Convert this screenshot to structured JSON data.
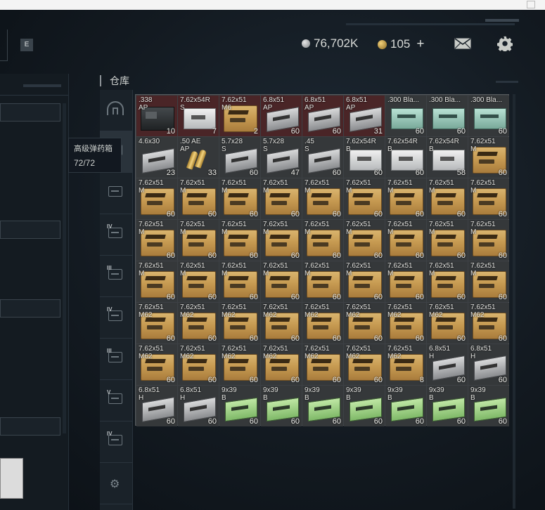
{
  "header": {
    "e_button": "E",
    "silver_amount": "76,702K",
    "gold_amount": "105",
    "add_label": "+"
  },
  "warehouse": {
    "title": "仓库"
  },
  "side_tabs": [
    {
      "level": "",
      "icon": "dome-icon",
      "active": false
    },
    {
      "level": "IV",
      "icon": "ammo-crate-icon",
      "active": true
    },
    {
      "level": "",
      "icon": "crate-icon",
      "active": false
    },
    {
      "level": "IV",
      "icon": "crate-icon",
      "active": false
    },
    {
      "level": "III",
      "icon": "crate-icon",
      "active": false
    },
    {
      "level": "IV",
      "icon": "crate-icon",
      "active": false
    },
    {
      "level": "III",
      "icon": "crate-icon",
      "active": false
    },
    {
      "level": "V",
      "icon": "crate-icon",
      "active": false
    },
    {
      "level": "IV",
      "icon": "crate-icon",
      "active": false
    },
    {
      "level": "",
      "icon": "gear-icon",
      "active": false
    }
  ],
  "tooltip": {
    "name": "高级弹药箱",
    "capacity": "72/72"
  },
  "grid": [
    [
      {
        "cal": ".338",
        "sub": "AP",
        "count": "10",
        "art": "box-dark",
        "red": true
      },
      {
        "cal": "7.62x54R",
        "sub": "S",
        "count": "7",
        "art": "box-white",
        "red": true
      },
      {
        "cal": "7.62x51",
        "sub": "M6",
        "count": "2",
        "art": "box-tan",
        "red": true
      },
      {
        "cal": "6.8x51",
        "sub": "AP",
        "count": "60",
        "art": "box-grey",
        "red": true
      },
      {
        "cal": "6.8x51",
        "sub": "AP",
        "count": "60",
        "art": "box-grey",
        "red": true
      },
      {
        "cal": "6.8x51",
        "sub": "AP",
        "count": "31",
        "art": "box-grey",
        "red": true
      },
      {
        "cal": ".300 Bla...",
        "sub": "",
        "count": "60",
        "art": "box-teal",
        "red": false
      },
      {
        "cal": ".300 Bla...",
        "sub": "",
        "count": "60",
        "art": "box-teal",
        "red": false
      },
      {
        "cal": ".300 Bla...",
        "sub": "",
        "count": "60",
        "art": "box-teal",
        "red": false
      }
    ],
    [
      {
        "cal": "4.6x30",
        "sub": "",
        "count": "23",
        "art": "box-grey",
        "red": false
      },
      {
        "cal": ".50 AE",
        "sub": "AP",
        "count": "33",
        "art": "rounds",
        "red": false
      },
      {
        "cal": "5.7x28",
        "sub": "S",
        "count": "60",
        "art": "box-grey",
        "red": false
      },
      {
        "cal": "5.7x28",
        "sub": "S",
        "count": "47",
        "art": "box-grey",
        "red": false
      },
      {
        "cal": ".45",
        "sub": "S",
        "count": "60",
        "art": "box-grey",
        "red": false
      },
      {
        "cal": "7.62x54R",
        "sub": "B",
        "count": "60",
        "art": "box-white",
        "red": false
      },
      {
        "cal": "7.62x54R",
        "sub": "B",
        "count": "60",
        "art": "box-white",
        "red": false
      },
      {
        "cal": "7.62x54R",
        "sub": "B",
        "count": "58",
        "art": "box-white",
        "red": false
      },
      {
        "cal": "7.62x51",
        "sub": "M",
        "count": "60",
        "art": "box-tan",
        "red": false
      }
    ],
    [
      {
        "cal": "7.62x51",
        "sub": "M",
        "count": "60",
        "art": "box-tan",
        "red": false
      },
      {
        "cal": "7.62x51",
        "sub": "M",
        "count": "60",
        "art": "box-tan",
        "red": false
      },
      {
        "cal": "7.62x51",
        "sub": "M",
        "count": "60",
        "art": "box-tan",
        "red": false
      },
      {
        "cal": "7.62x51",
        "sub": "M",
        "count": "60",
        "art": "box-tan",
        "red": false
      },
      {
        "cal": "7.62x51",
        "sub": "M",
        "count": "60",
        "art": "box-tan",
        "red": false
      },
      {
        "cal": "7.62x51",
        "sub": "M",
        "count": "60",
        "art": "box-tan",
        "red": false
      },
      {
        "cal": "7.62x51",
        "sub": "M",
        "count": "60",
        "art": "box-tan",
        "red": false
      },
      {
        "cal": "7.62x51",
        "sub": "M",
        "count": "60",
        "art": "box-tan",
        "red": false
      },
      {
        "cal": "7.62x51",
        "sub": "M",
        "count": "60",
        "art": "box-tan",
        "red": false
      }
    ],
    [
      {
        "cal": "7.62x51",
        "sub": "M",
        "count": "60",
        "art": "box-tan",
        "red": false
      },
      {
        "cal": "7.62x51",
        "sub": "M",
        "count": "60",
        "art": "box-tan",
        "red": false
      },
      {
        "cal": "7.62x51",
        "sub": "M",
        "count": "60",
        "art": "box-tan",
        "red": false
      },
      {
        "cal": "7.62x51",
        "sub": "M",
        "count": "60",
        "art": "box-tan",
        "red": false
      },
      {
        "cal": "7.62x51",
        "sub": "M",
        "count": "60",
        "art": "box-tan",
        "red": false
      },
      {
        "cal": "7.62x51",
        "sub": "M",
        "count": "60",
        "art": "box-tan",
        "red": false
      },
      {
        "cal": "7.62x51",
        "sub": "M",
        "count": "60",
        "art": "box-tan",
        "red": false
      },
      {
        "cal": "7.62x51",
        "sub": "M",
        "count": "60",
        "art": "box-tan",
        "red": false
      },
      {
        "cal": "7.62x51",
        "sub": "M",
        "count": "60",
        "art": "box-tan",
        "red": false
      }
    ],
    [
      {
        "cal": "7.62x51",
        "sub": "M",
        "count": "60",
        "art": "box-tan",
        "red": false
      },
      {
        "cal": "7.62x51",
        "sub": "M",
        "count": "60",
        "art": "box-tan",
        "red": false
      },
      {
        "cal": "7.62x51",
        "sub": "M",
        "count": "60",
        "art": "box-tan",
        "red": false
      },
      {
        "cal": "7.62x51",
        "sub": "M",
        "count": "60",
        "art": "box-tan",
        "red": false
      },
      {
        "cal": "7.62x51",
        "sub": "M",
        "count": "60",
        "art": "box-tan",
        "red": false
      },
      {
        "cal": "7.62x51",
        "sub": "M",
        "count": "60",
        "art": "box-tan",
        "red": false
      },
      {
        "cal": "7.62x51",
        "sub": "M",
        "count": "60",
        "art": "box-tan",
        "red": false
      },
      {
        "cal": "7.62x51",
        "sub": "M",
        "count": "60",
        "art": "box-tan",
        "red": false
      },
      {
        "cal": "7.62x51",
        "sub": "M",
        "count": "60",
        "art": "box-tan",
        "red": false
      }
    ],
    [
      {
        "cal": "7.62x51",
        "sub": "M62",
        "count": "60",
        "art": "box-tan",
        "red": false
      },
      {
        "cal": "7.62x51",
        "sub": "M62",
        "count": "60",
        "art": "box-tan",
        "red": false
      },
      {
        "cal": "7.62x51",
        "sub": "M62",
        "count": "60",
        "art": "box-tan",
        "red": false
      },
      {
        "cal": "7.62x51",
        "sub": "M62",
        "count": "60",
        "art": "box-tan",
        "red": false
      },
      {
        "cal": "7.62x51",
        "sub": "M62",
        "count": "60",
        "art": "box-tan",
        "red": false
      },
      {
        "cal": "7.62x51",
        "sub": "M62",
        "count": "60",
        "art": "box-tan",
        "red": false
      },
      {
        "cal": "7.62x51",
        "sub": "M62",
        "count": "60",
        "art": "box-tan",
        "red": false
      },
      {
        "cal": "7.62x51",
        "sub": "M62",
        "count": "60",
        "art": "box-tan",
        "red": false
      },
      {
        "cal": "7.62x51",
        "sub": "M62",
        "count": "60",
        "art": "box-tan",
        "red": false
      }
    ],
    [
      {
        "cal": "7.62x51",
        "sub": "M62",
        "count": "60",
        "art": "box-tan",
        "red": false
      },
      {
        "cal": "7.62x51",
        "sub": "M62",
        "count": "60",
        "art": "box-tan",
        "red": false
      },
      {
        "cal": "7.62x51",
        "sub": "M62",
        "count": "60",
        "art": "box-tan",
        "red": false
      },
      {
        "cal": "7.62x51",
        "sub": "M62",
        "count": "60",
        "art": "box-tan",
        "red": false
      },
      {
        "cal": "7.62x51",
        "sub": "M62",
        "count": "60",
        "art": "box-tan",
        "red": false
      },
      {
        "cal": "7.62x51",
        "sub": "M62",
        "count": "60",
        "art": "box-tan",
        "red": false
      },
      {
        "cal": "7.62x51",
        "sub": "M62",
        "count": "8",
        "art": "box-tan",
        "red": false
      },
      {
        "cal": "6.8x51",
        "sub": "H",
        "count": "60",
        "art": "box-grey",
        "red": false
      },
      {
        "cal": "6.8x51",
        "sub": "H",
        "count": "60",
        "art": "box-grey",
        "red": false
      }
    ],
    [
      {
        "cal": "6.8x51",
        "sub": "H",
        "count": "60",
        "art": "box-grey",
        "red": false
      },
      {
        "cal": "6.8x51",
        "sub": "H",
        "count": "60",
        "art": "box-grey",
        "red": false
      },
      {
        "cal": "9x39",
        "sub": "B",
        "count": "60",
        "art": "box-green",
        "red": false
      },
      {
        "cal": "9x39",
        "sub": "B",
        "count": "60",
        "art": "box-green",
        "red": false
      },
      {
        "cal": "9x39",
        "sub": "B",
        "count": "60",
        "art": "box-green",
        "red": false
      },
      {
        "cal": "9x39",
        "sub": "B",
        "count": "60",
        "art": "box-green",
        "red": false
      },
      {
        "cal": "9x39",
        "sub": "B",
        "count": "60",
        "art": "box-green",
        "red": false
      },
      {
        "cal": "9x39",
        "sub": "B",
        "count": "60",
        "art": "box-green",
        "red": false
      },
      {
        "cal": "9x39",
        "sub": "B",
        "count": "60",
        "art": "box-green",
        "red": false
      }
    ]
  ]
}
